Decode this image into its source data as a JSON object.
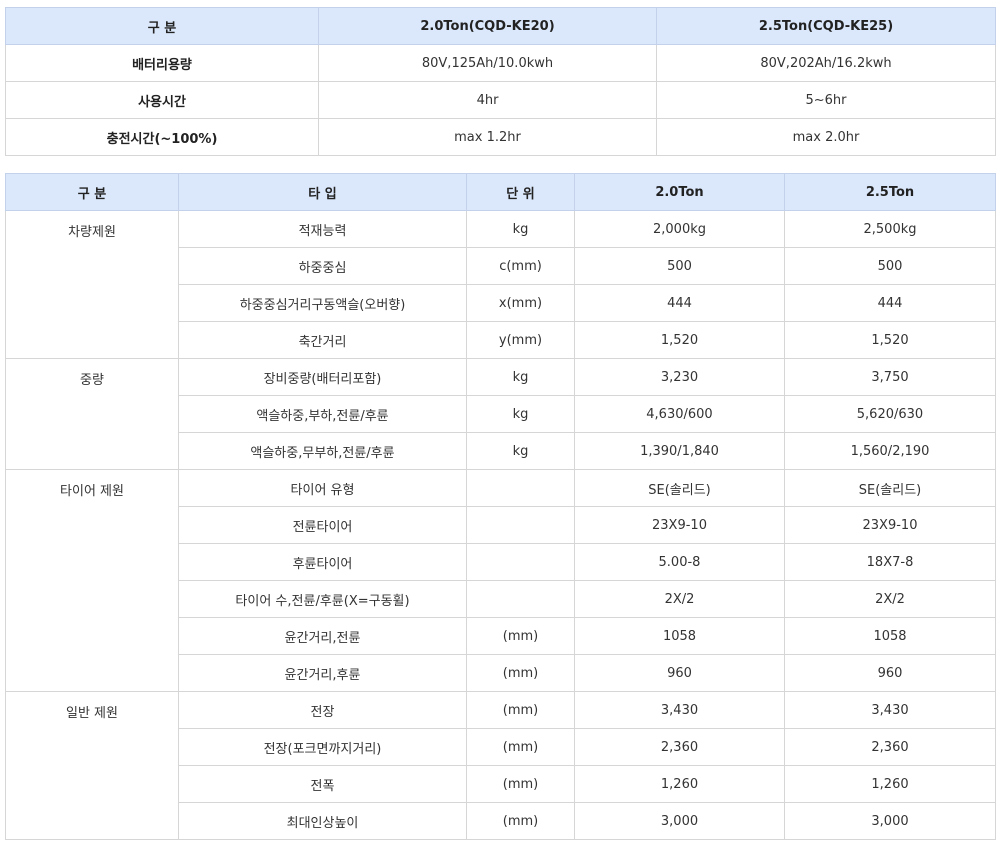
{
  "battery": {
    "header": [
      "구 분",
      "2.0Ton(CQD-KE20)",
      "2.5Ton(CQD-KE25)"
    ],
    "rows": [
      [
        "배터리용량",
        "80V,125Ah/10.0kwh",
        "80V,202Ah/16.2kwh"
      ],
      [
        "사용시간",
        "4hr",
        "5~6hr"
      ],
      [
        "충전시간(~100%)",
        "max 1.2hr",
        "max 2.0hr"
      ]
    ]
  },
  "specs": {
    "header": [
      "구 분",
      "타 입",
      "단 위",
      "2.0Ton",
      "2.5Ton"
    ],
    "groups": [
      {
        "name": "차량제원",
        "rows": [
          [
            "적재능력",
            "kg",
            "2,000kg",
            "2,500kg"
          ],
          [
            "하중중심",
            "c(mm)",
            "500",
            "500"
          ],
          [
            "하중중심거리구동액슬(오버향)",
            "x(mm)",
            "444",
            "444"
          ],
          [
            "축간거리",
            "y(mm)",
            "1,520",
            "1,520"
          ]
        ]
      },
      {
        "name": "중량",
        "rows": [
          [
            "장비중량(배터리포함)",
            "kg",
            "3,230",
            "3,750"
          ],
          [
            "액슬하중,부하,전륜/후륜",
            "kg",
            "4,630/600",
            "5,620/630"
          ],
          [
            "액슬하중,무부하,전륜/후륜",
            "kg",
            "1,390/1,840",
            "1,560/2,190"
          ]
        ]
      },
      {
        "name": "타이어 제원",
        "rows": [
          [
            "타이어 유형",
            "",
            "SE(솔리드)",
            "SE(솔리드)"
          ],
          [
            "전륜타이어",
            "",
            "23X9-10",
            "23X9-10"
          ],
          [
            "후륜타이어",
            "",
            "5.00-8",
            "18X7-8"
          ],
          [
            "타이어 수,전륜/후륜(X=구동휠)",
            "",
            "2X/2",
            "2X/2"
          ],
          [
            "윤간거리,전륜",
            "(mm)",
            "1058",
            "1058"
          ],
          [
            "윤간거리,후륜",
            "(mm)",
            "960",
            "960"
          ]
        ]
      },
      {
        "name": "일반 제원",
        "rows": [
          [
            "전장",
            "(mm)",
            "3,430",
            "3,430"
          ],
          [
            "전장(포크면까지거리)",
            "(mm)",
            "2,360",
            "2,360"
          ],
          [
            "전폭",
            "(mm)",
            "1,260",
            "1,260"
          ],
          [
            "최대인상높이",
            "(mm)",
            "3,000",
            "3,000"
          ]
        ]
      }
    ]
  }
}
